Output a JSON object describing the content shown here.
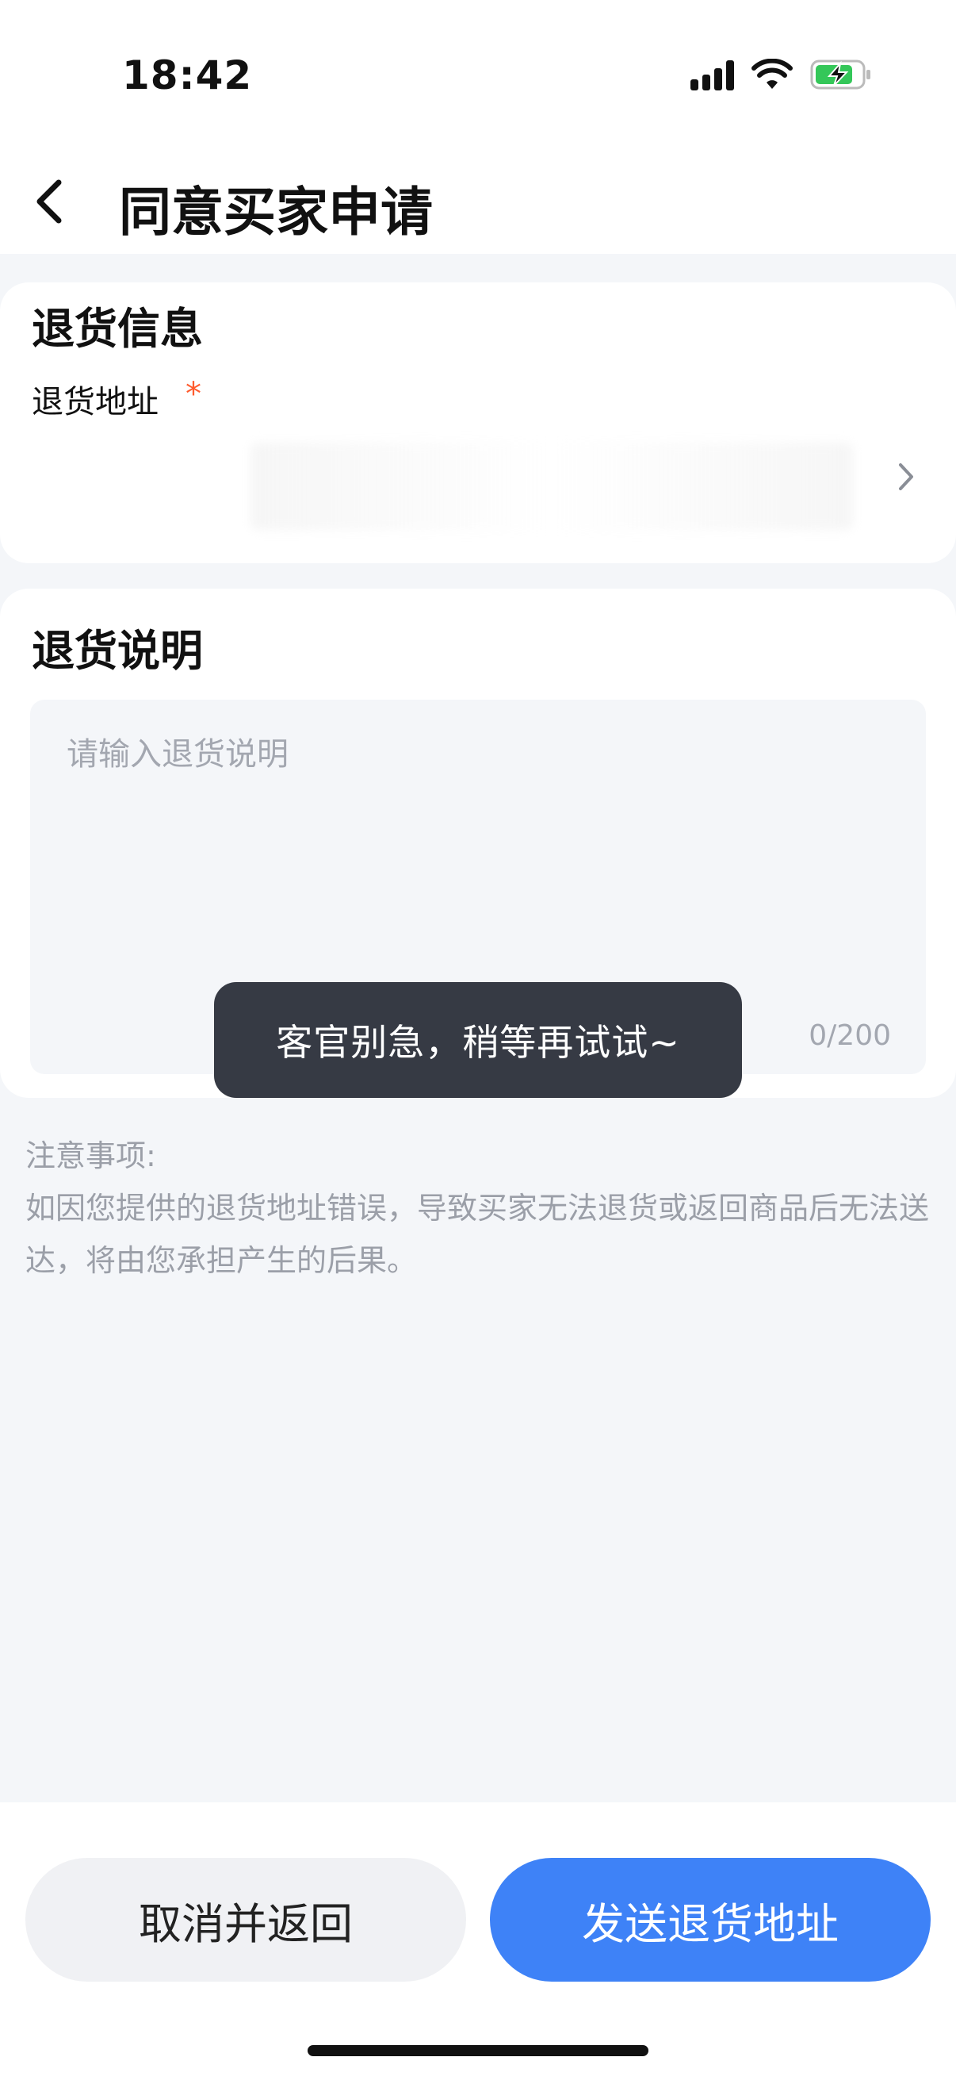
{
  "status_bar": {
    "time": "18:42"
  },
  "header": {
    "title": "同意买家申请"
  },
  "return_info": {
    "section_title": "退货信息",
    "address_label": "退货地址",
    "required_mark": "*"
  },
  "return_desc": {
    "section_title": "退货说明",
    "placeholder": "请输入退货说明",
    "counter": "0/200"
  },
  "notice": {
    "title": "注意事项:",
    "body": "如因您提供的退货地址错误，导致买家无法退货或返回商品后无法送达，将由您承担产生的后果。"
  },
  "toast": {
    "message": "客官别急，稍等再试试~"
  },
  "actions": {
    "cancel_label": "取消并返回",
    "send_label": "发送退货地址"
  },
  "colors": {
    "accent": "#3e82f7",
    "required": "#ff5b2e",
    "background": "#f4f6f9",
    "toast_bg": "#363a44"
  }
}
